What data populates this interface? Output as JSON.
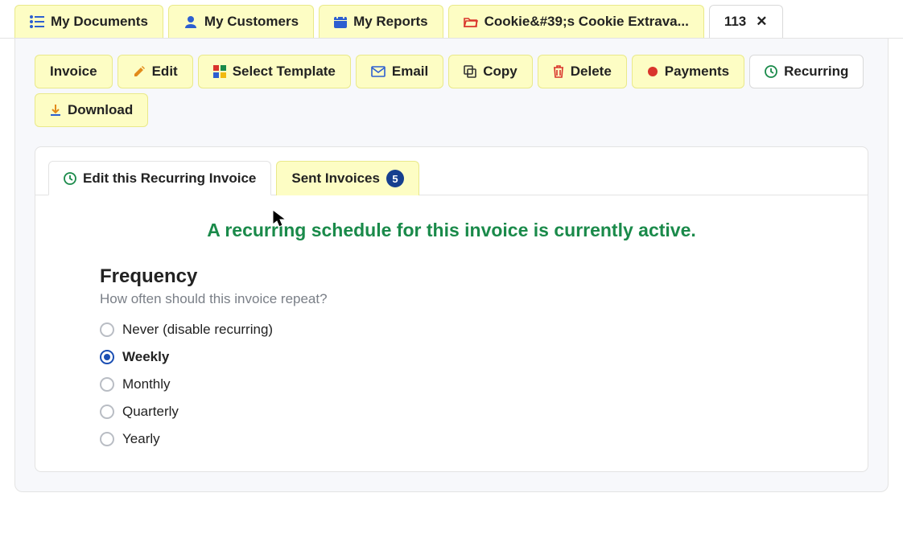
{
  "top_tabs": {
    "my_documents": "My Documents",
    "my_customers": "My Customers",
    "my_reports": "My Reports",
    "open_doc": "Cookie&#39;s Cookie Extrava...",
    "active_doc": "113"
  },
  "toolbar": {
    "invoice": "Invoice",
    "edit": "Edit",
    "select_template": "Select Template",
    "email": "Email",
    "copy": "Copy",
    "delete": "Delete",
    "payments": "Payments",
    "recurring": "Recurring",
    "download": "Download"
  },
  "inner_tabs": {
    "edit_recurring": "Edit this Recurring Invoice",
    "sent_invoices": "Sent Invoices",
    "sent_count": "5"
  },
  "status_message": "A recurring schedule for this invoice is currently active.",
  "frequency": {
    "title": "Frequency",
    "subtitle": "How often should this invoice repeat?",
    "options": {
      "never": "Never (disable recurring)",
      "weekly": "Weekly",
      "monthly": "Monthly",
      "quarterly": "Quarterly",
      "yearly": "Yearly"
    },
    "selected": "weekly"
  }
}
